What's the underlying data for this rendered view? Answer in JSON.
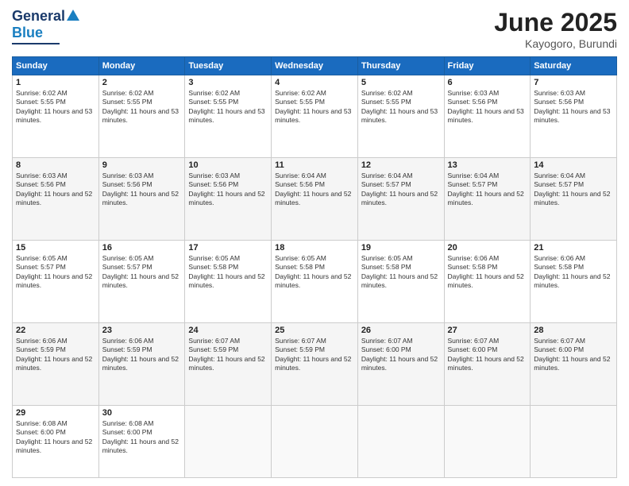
{
  "header": {
    "logo_general": "General",
    "logo_blue": "Blue",
    "month_title": "June 2025",
    "location": "Kayogoro, Burundi"
  },
  "days_of_week": [
    "Sunday",
    "Monday",
    "Tuesday",
    "Wednesday",
    "Thursday",
    "Friday",
    "Saturday"
  ],
  "weeks": [
    [
      {
        "day": "1",
        "sunrise": "6:02 AM",
        "sunset": "5:55 PM",
        "daylight": "11 hours and 53 minutes."
      },
      {
        "day": "2",
        "sunrise": "6:02 AM",
        "sunset": "5:55 PM",
        "daylight": "11 hours and 53 minutes."
      },
      {
        "day": "3",
        "sunrise": "6:02 AM",
        "sunset": "5:55 PM",
        "daylight": "11 hours and 53 minutes."
      },
      {
        "day": "4",
        "sunrise": "6:02 AM",
        "sunset": "5:55 PM",
        "daylight": "11 hours and 53 minutes."
      },
      {
        "day": "5",
        "sunrise": "6:02 AM",
        "sunset": "5:55 PM",
        "daylight": "11 hours and 53 minutes."
      },
      {
        "day": "6",
        "sunrise": "6:03 AM",
        "sunset": "5:56 PM",
        "daylight": "11 hours and 53 minutes."
      },
      {
        "day": "7",
        "sunrise": "6:03 AM",
        "sunset": "5:56 PM",
        "daylight": "11 hours and 53 minutes."
      }
    ],
    [
      {
        "day": "8",
        "sunrise": "6:03 AM",
        "sunset": "5:56 PM",
        "daylight": "11 hours and 52 minutes."
      },
      {
        "day": "9",
        "sunrise": "6:03 AM",
        "sunset": "5:56 PM",
        "daylight": "11 hours and 52 minutes."
      },
      {
        "day": "10",
        "sunrise": "6:03 AM",
        "sunset": "5:56 PM",
        "daylight": "11 hours and 52 minutes."
      },
      {
        "day": "11",
        "sunrise": "6:04 AM",
        "sunset": "5:56 PM",
        "daylight": "11 hours and 52 minutes."
      },
      {
        "day": "12",
        "sunrise": "6:04 AM",
        "sunset": "5:57 PM",
        "daylight": "11 hours and 52 minutes."
      },
      {
        "day": "13",
        "sunrise": "6:04 AM",
        "sunset": "5:57 PM",
        "daylight": "11 hours and 52 minutes."
      },
      {
        "day": "14",
        "sunrise": "6:04 AM",
        "sunset": "5:57 PM",
        "daylight": "11 hours and 52 minutes."
      }
    ],
    [
      {
        "day": "15",
        "sunrise": "6:05 AM",
        "sunset": "5:57 PM",
        "daylight": "11 hours and 52 minutes."
      },
      {
        "day": "16",
        "sunrise": "6:05 AM",
        "sunset": "5:57 PM",
        "daylight": "11 hours and 52 minutes."
      },
      {
        "day": "17",
        "sunrise": "6:05 AM",
        "sunset": "5:58 PM",
        "daylight": "11 hours and 52 minutes."
      },
      {
        "day": "18",
        "sunrise": "6:05 AM",
        "sunset": "5:58 PM",
        "daylight": "11 hours and 52 minutes."
      },
      {
        "day": "19",
        "sunrise": "6:05 AM",
        "sunset": "5:58 PM",
        "daylight": "11 hours and 52 minutes."
      },
      {
        "day": "20",
        "sunrise": "6:06 AM",
        "sunset": "5:58 PM",
        "daylight": "11 hours and 52 minutes."
      },
      {
        "day": "21",
        "sunrise": "6:06 AM",
        "sunset": "5:58 PM",
        "daylight": "11 hours and 52 minutes."
      }
    ],
    [
      {
        "day": "22",
        "sunrise": "6:06 AM",
        "sunset": "5:59 PM",
        "daylight": "11 hours and 52 minutes."
      },
      {
        "day": "23",
        "sunrise": "6:06 AM",
        "sunset": "5:59 PM",
        "daylight": "11 hours and 52 minutes."
      },
      {
        "day": "24",
        "sunrise": "6:07 AM",
        "sunset": "5:59 PM",
        "daylight": "11 hours and 52 minutes."
      },
      {
        "day": "25",
        "sunrise": "6:07 AM",
        "sunset": "5:59 PM",
        "daylight": "11 hours and 52 minutes."
      },
      {
        "day": "26",
        "sunrise": "6:07 AM",
        "sunset": "6:00 PM",
        "daylight": "11 hours and 52 minutes."
      },
      {
        "day": "27",
        "sunrise": "6:07 AM",
        "sunset": "6:00 PM",
        "daylight": "11 hours and 52 minutes."
      },
      {
        "day": "28",
        "sunrise": "6:07 AM",
        "sunset": "6:00 PM",
        "daylight": "11 hours and 52 minutes."
      }
    ],
    [
      {
        "day": "29",
        "sunrise": "6:08 AM",
        "sunset": "6:00 PM",
        "daylight": "11 hours and 52 minutes."
      },
      {
        "day": "30",
        "sunrise": "6:08 AM",
        "sunset": "6:00 PM",
        "daylight": "11 hours and 52 minutes."
      },
      null,
      null,
      null,
      null,
      null
    ]
  ]
}
